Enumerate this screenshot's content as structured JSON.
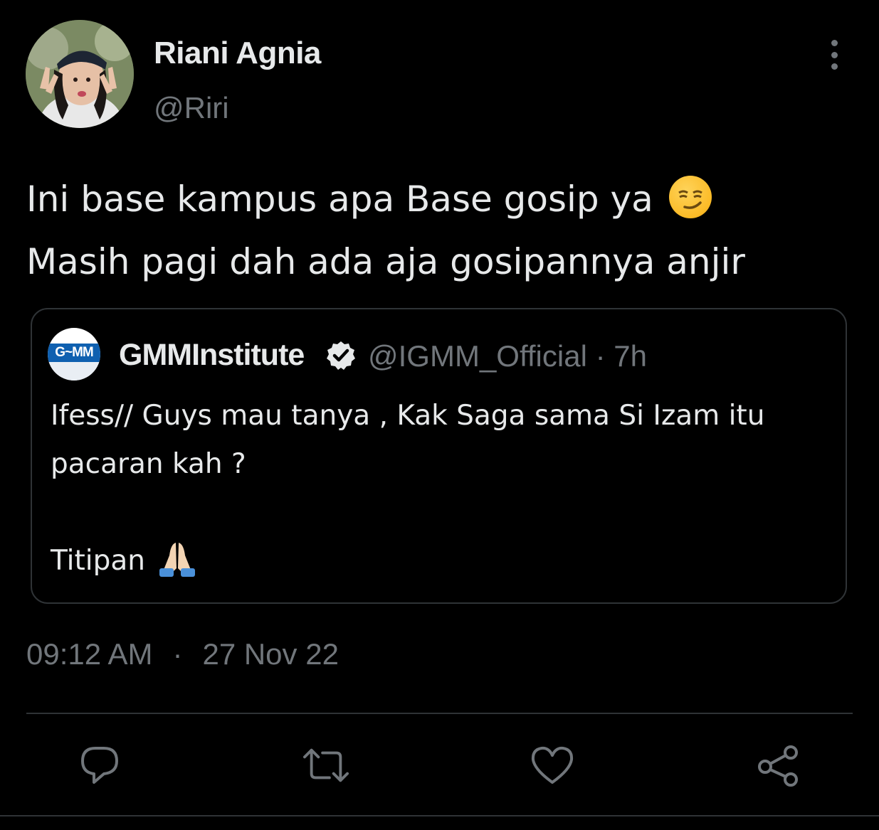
{
  "author": {
    "display_name": "Riani Agnia",
    "handle": "@Riri"
  },
  "tweet": {
    "text": "Ini base kampus apa Base gosip ya",
    "text_line2": "Masih pagi dah ada aja gosipannya anjir",
    "emoji": "smirking-face"
  },
  "quoted_tweet": {
    "display_name": "GMMInstitute",
    "verified": true,
    "handle": "@IGMM_Official",
    "time_ago": "· 7h",
    "avatar_text": "G~MM",
    "text": "Ifess// Guys mau tanya , Kak Saga sama Si Izam itu\npacaran kah ?\n\nTitipan",
    "emoji": "folded-hands"
  },
  "meta": {
    "time": "09:12 AM",
    "separator": "·",
    "date": "27 Nov 22"
  },
  "actions": [
    "reply-icon",
    "retweet-icon",
    "like-icon",
    "share-icon"
  ],
  "colors": {
    "background": "#000000",
    "text": "#e7e9ea",
    "secondary_text": "#71767b",
    "border": "#2f3336"
  }
}
